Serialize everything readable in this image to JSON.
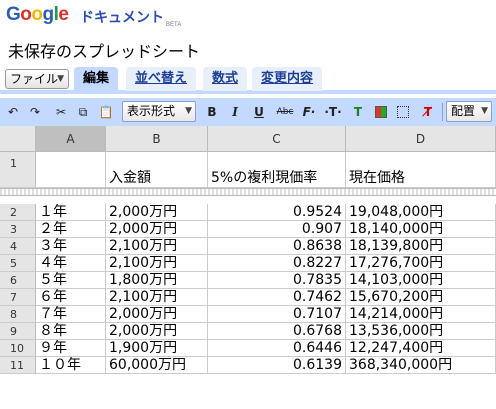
{
  "app": {
    "logo_text": "Google",
    "product": "ドキュメント",
    "beta": "BETA",
    "doc_title": "未保存のスプレッドシート"
  },
  "menu": {
    "file_label": "ファイル",
    "tabs": [
      {
        "label": "編集",
        "active": true
      },
      {
        "label": "並べ替え",
        "active": false
      },
      {
        "label": "数式",
        "active": false
      },
      {
        "label": "変更内容",
        "active": false
      }
    ]
  },
  "toolbar": {
    "format_label": "表示形式",
    "align_label": "配置",
    "bold": "B",
    "italic": "I",
    "underline": "U",
    "strike": "Abc"
  },
  "columns": [
    "A",
    "B",
    "C",
    "D"
  ],
  "header_row": {
    "num": "1",
    "a": "",
    "b": "入金額",
    "c": "5%の複利現価率",
    "d": "現在価格"
  },
  "rows": [
    {
      "num": "2",
      "a": "１年",
      "b": "2,000万円",
      "c": "0.9524",
      "d": "19,048,000円"
    },
    {
      "num": "3",
      "a": "２年",
      "b": "2,000万円",
      "c": "0.907",
      "d": "18,140,000円"
    },
    {
      "num": "4",
      "a": "３年",
      "b": "2,100万円",
      "c": "0.8638",
      "d": "18,139,800円"
    },
    {
      "num": "5",
      "a": "４年",
      "b": "2,100万円",
      "c": "0.8227",
      "d": "17,276,700円"
    },
    {
      "num": "6",
      "a": "５年",
      "b": "1,800万円",
      "c": "0.7835",
      "d": "14,103,000円"
    },
    {
      "num": "7",
      "a": "６年",
      "b": "2,100万円",
      "c": "0.7462",
      "d": "15,670,200円"
    },
    {
      "num": "8",
      "a": "７年",
      "b": "2,000万円",
      "c": "0.7107",
      "d": "14,214,000円"
    },
    {
      "num": "9",
      "a": "８年",
      "b": "2,000万円",
      "c": "0.6768",
      "d": "13,536,000円"
    },
    {
      "num": "10",
      "a": "９年",
      "b": "1,900万円",
      "c": "0.6446",
      "d": "12,247,400円"
    },
    {
      "num": "11",
      "a": "１０年",
      "b": "60,000万円",
      "c": "0.6139",
      "d": "368,340,000円"
    }
  ]
}
